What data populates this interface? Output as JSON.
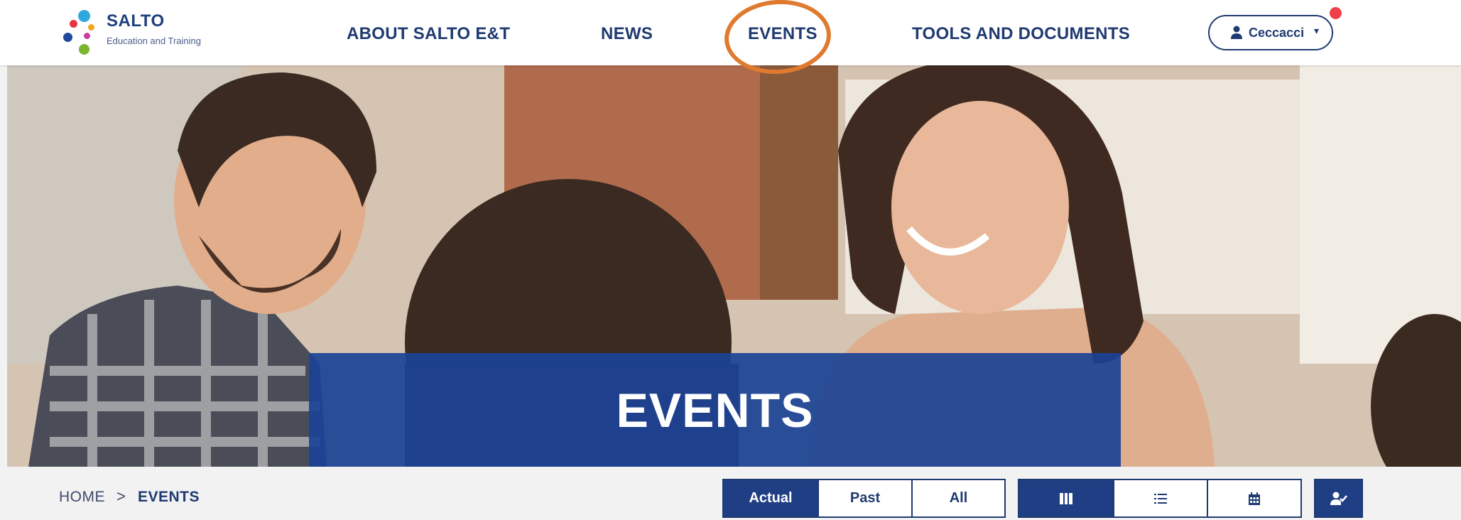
{
  "logo": {
    "title": "SALTO",
    "subtitle": "Education and Training",
    "dot_colors": [
      "#e8343f",
      "#2fa8e0",
      "#f2a81d",
      "#7bb52e",
      "#1f4a9c",
      "#c83fa0"
    ]
  },
  "nav": {
    "items": [
      "ABOUT SALTO E&T",
      "NEWS",
      "EVENTS",
      "TOOLS AND DOCUMENTS"
    ],
    "highlighted": "EVENTS"
  },
  "user": {
    "name": "Ceccacci",
    "icon": "person-icon",
    "has_notification": true
  },
  "hero": {
    "title": "EVENTS"
  },
  "breadcrumb": {
    "home": "HOME",
    "separator": ">",
    "current": "EVENTS"
  },
  "filters": {
    "time": [
      "Actual",
      "Past",
      "All"
    ],
    "time_selected": "Actual",
    "views": [
      "grid-view-icon",
      "list-view-icon",
      "calendar-icon"
    ],
    "view_selected": "grid-view-icon",
    "extra": "user-check-icon"
  },
  "colors": {
    "primary": "#1f3a70",
    "banner": "#1b4296",
    "highlight": "#e07a2f",
    "notification": "#ee3f48"
  }
}
